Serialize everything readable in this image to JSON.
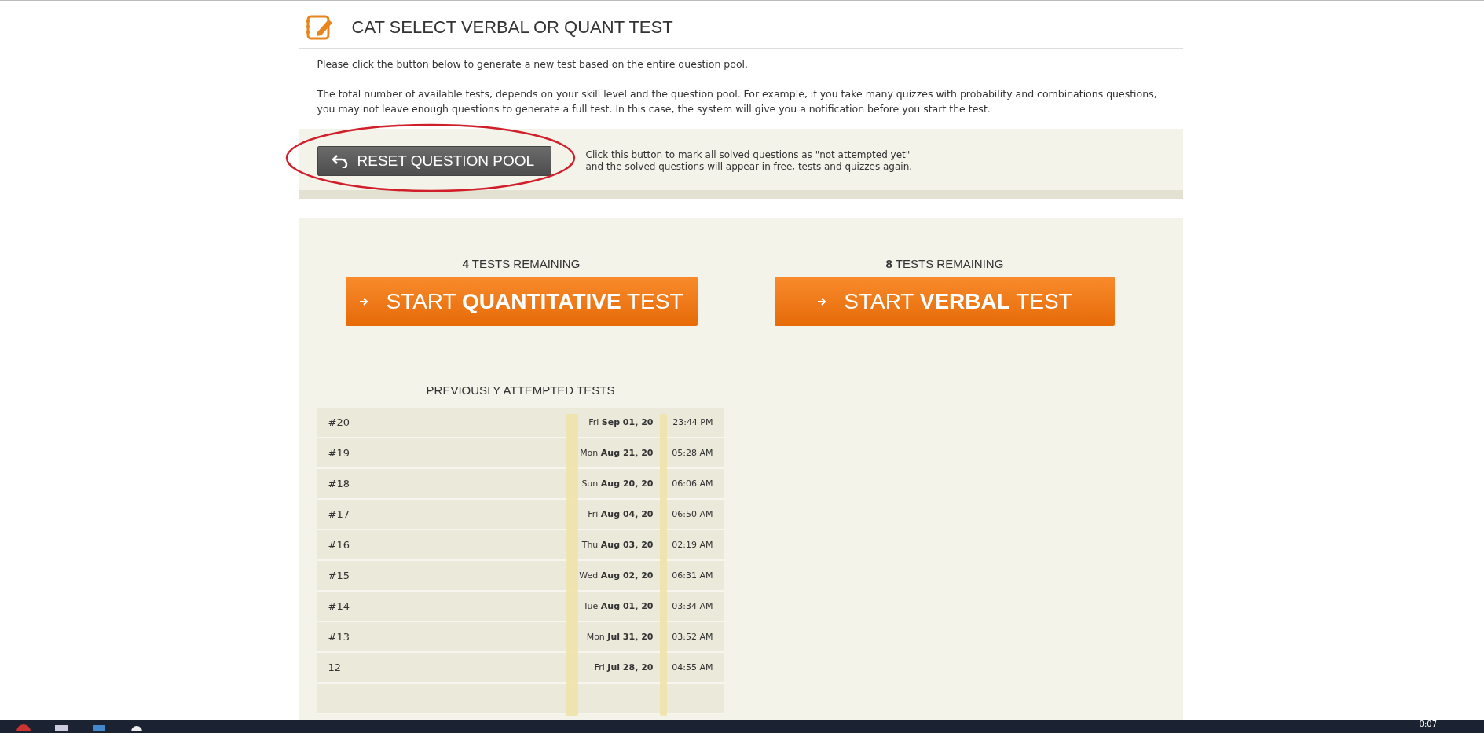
{
  "header": {
    "title": "CAT SELECT VERBAL OR QUANT TEST"
  },
  "intro": [
    "Please click the button below to generate a new test based on the entire question pool.",
    "The total number of available tests, depends on your skill level and the question pool. For example, if you take many quizzes with probability and combinations questions, you may not leave enough questions to generate a full test. In this case, the system will give you a notification before you start the test."
  ],
  "reset": {
    "button": "RESET QUESTION POOL",
    "note_lines": [
      "Click this button to mark all solved questions as \"not attempted yet\"",
      "and the solved questions will appear in free, tests and quizzes again."
    ]
  },
  "tests": [
    {
      "remaining": "**4** TESTS REMAINING",
      "button": "START **QUANTITATIVE** TEST"
    },
    {
      "remaining": "**8** TESTS REMAINING",
      "button": "START **VERBAL** TEST"
    }
  ],
  "history": {
    "title": "PREVIOUSLY ATTEMPTED TESTS",
    "rows": [
      {
        "name": "#20",
        "date": "Fri **Sep 01, 20**",
        "time": "23:44 PM"
      },
      {
        "name": "#19",
        "date": "Mon **Aug 21, 20**",
        "time": "05:28 AM"
      },
      {
        "name": "#18",
        "date": "Sun **Aug 20, 20**",
        "time": "06:06 AM"
      },
      {
        "name": "#17",
        "date": "Fri **Aug 04, 20**",
        "time": "06:50 AM"
      },
      {
        "name": "#16",
        "date": "Thu **Aug 03, 20**",
        "time": "02:19 AM"
      },
      {
        "name": "#15",
        "date": "Wed **Aug 02, 20**",
        "time": "06:31 AM"
      },
      {
        "name": "#14",
        "date": "Tue **Aug 01, 20**",
        "time": "03:34 AM"
      },
      {
        "name": "#13",
        "date": "Mon **Jul 31, 20**",
        "time": "03:52 AM"
      },
      {
        "name": "12",
        "date": "Fri **Jul 28, 20**",
        "time": "04:55 AM"
      }
    ]
  },
  "taskbar": {
    "clock": "0:07"
  }
}
